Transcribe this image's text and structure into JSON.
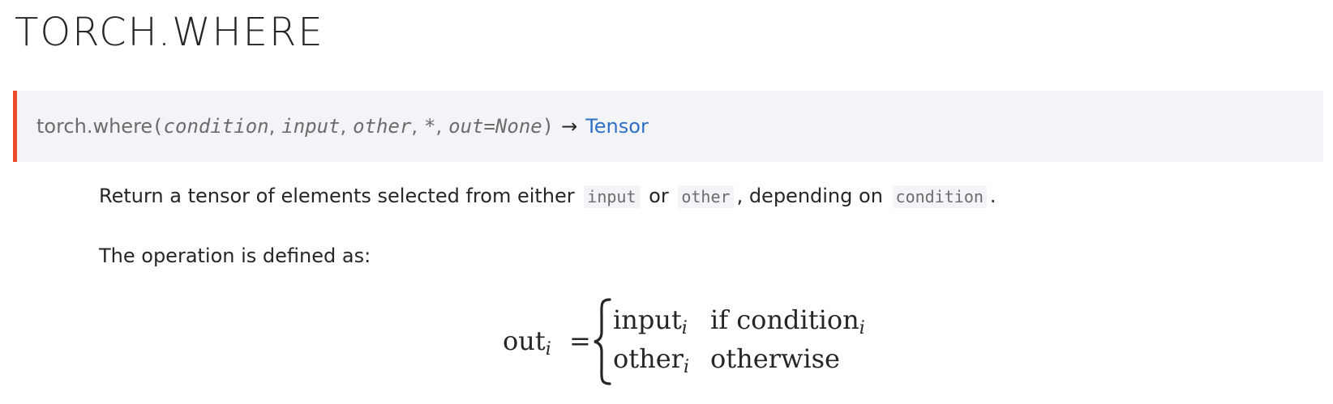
{
  "page": {
    "title": "TORCH.WHERE"
  },
  "signature": {
    "function": "torch.where",
    "open_paren": "(",
    "close_paren": ")",
    "params": [
      "condition",
      "input",
      "other",
      "*",
      "out=None"
    ],
    "separator": ",",
    "arrow": "→",
    "return_type": "Tensor",
    "accent_color": "#ee4c2c",
    "link_color": "#2f70c5"
  },
  "description": {
    "part1": "Return a tensor of elements selected from either",
    "code1": "input",
    "part2": "or",
    "code2": "other",
    "part3": ", depending on",
    "code3": "condition",
    "part4": "."
  },
  "definition_intro": "The operation is defined as:",
  "formula": {
    "lhs": "out",
    "lhs_sub": "i",
    "equals": "=",
    "cases": [
      {
        "value": "input",
        "value_sub": "i",
        "condition": "if condition",
        "condition_sub": "i"
      },
      {
        "value": "other",
        "value_sub": "i",
        "condition": "otherwise",
        "condition_sub": ""
      }
    ]
  }
}
